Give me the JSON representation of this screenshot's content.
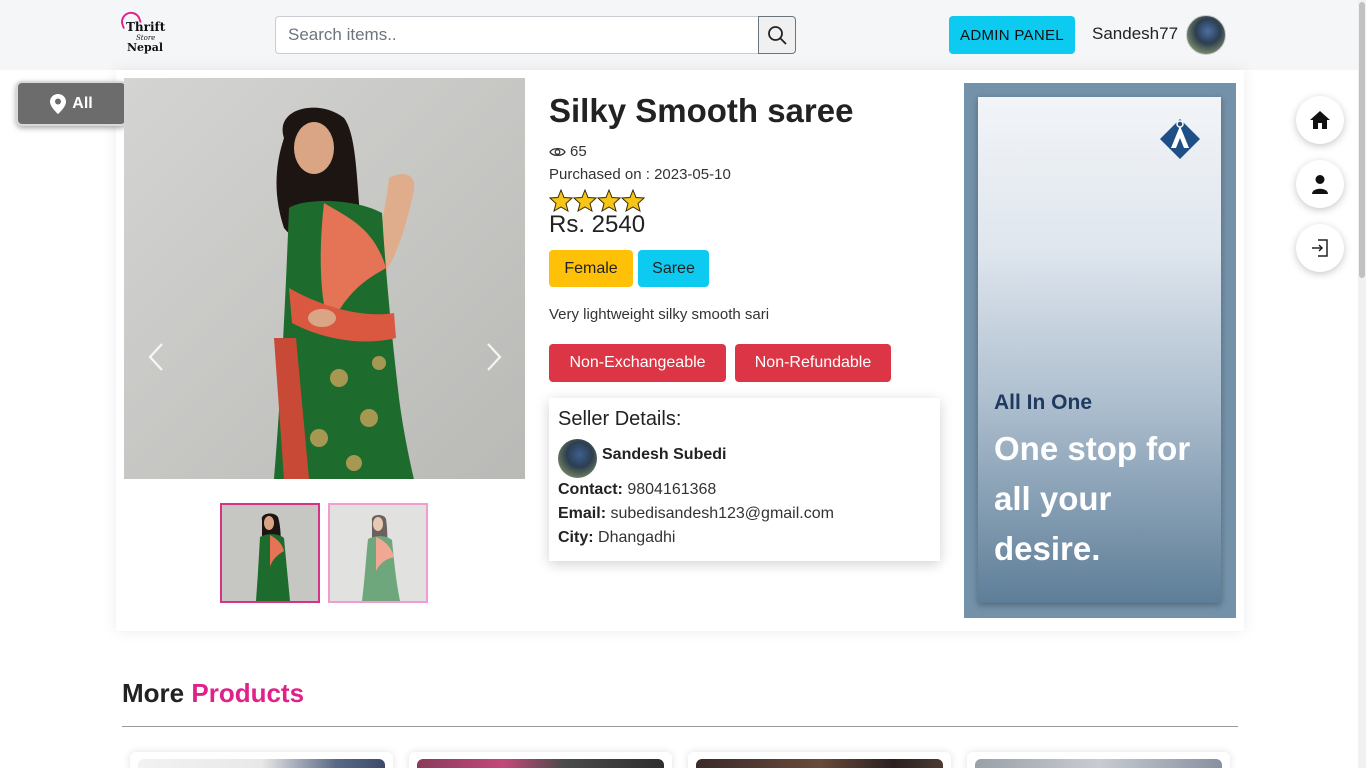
{
  "header": {
    "logo_line1": "Thrift",
    "logo_line2": "Store",
    "logo_line3": "Nepal",
    "search_placeholder": "Search items..",
    "admin_label": "ADMIN PANEL",
    "username": "Sandesh77"
  },
  "location": {
    "label": "All"
  },
  "product": {
    "title": "Silky Smooth saree",
    "views": "65",
    "purchased": "Purchased on : 2023-05-10",
    "rating": 4,
    "price": "Rs. 2540",
    "gender_tag": "Female",
    "category_tag": "Saree",
    "description": "Very lightweight silky smooth sari",
    "policy1": "Non-Exchangeable",
    "policy2": "Non-Refundable"
  },
  "seller": {
    "heading": "Seller Details:",
    "name": "Sandesh Subedi",
    "contact_label": "Contact:",
    "contact": "9804161368",
    "email_label": "Email:",
    "email": "subedisandesh123@gmail.com",
    "city_label": "City:",
    "city": "Dhangadhi"
  },
  "ad": {
    "brand": "All In One",
    "slogan": "One stop for all your desire."
  },
  "more": {
    "heading_plain": "More",
    "heading_accent": "Products"
  },
  "colors": {
    "accent": "#e0218a",
    "info": "#0dcaf0",
    "warning": "#ffc107",
    "danger": "#dc3545",
    "star": "#f5c518"
  },
  "icons": {
    "search": "search-icon",
    "location": "location-pin-icon",
    "views": "eye-icon",
    "home": "home-icon",
    "profile": "user-icon",
    "logout": "logout-icon"
  }
}
